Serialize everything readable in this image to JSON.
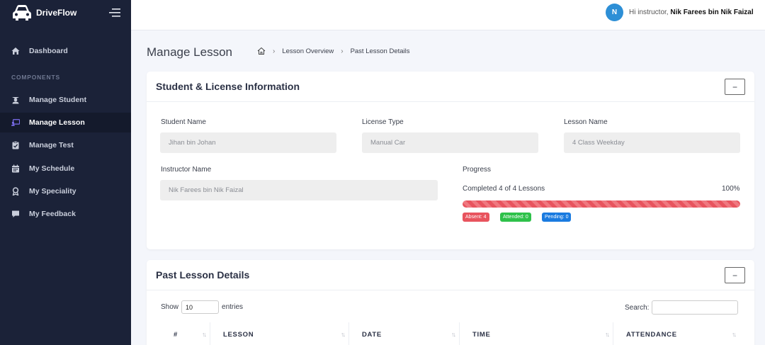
{
  "brand": {
    "name": "DriveFlow"
  },
  "sidebar": {
    "section_label": "COMPONENTS",
    "items": [
      {
        "label": "Dashboard",
        "icon": "home-icon"
      },
      {
        "label": "Manage Student",
        "icon": "student-icon"
      },
      {
        "label": "Manage Lesson",
        "icon": "lesson-icon",
        "active": true
      },
      {
        "label": "Manage Test",
        "icon": "clipboard-icon"
      },
      {
        "label": "My Schedule",
        "icon": "calendar-icon"
      },
      {
        "label": "My Speciality",
        "icon": "award-icon"
      },
      {
        "label": "My Feedback",
        "icon": "comment-icon"
      }
    ]
  },
  "topbar": {
    "avatar_initial": "N",
    "greeting": "Hi instructor,",
    "user_name": "Nik Farees bin Nik Faizal"
  },
  "page": {
    "title": "Manage Lesson",
    "breadcrumb": [
      "Lesson Overview",
      "Past Lesson Details"
    ]
  },
  "info_card": {
    "title": "Student & License Information",
    "collapse_symbol": "−",
    "student_name_label": "Student Name",
    "student_name": "Jihan bin Johan",
    "license_type_label": "License Type",
    "license_type": "Manual Car",
    "lesson_name_label": "Lesson Name",
    "lesson_name": "4 Class Weekday",
    "instructor_name_label": "Instructor Name",
    "instructor_name": "Nik Farees bin Nik Faizal",
    "progress_label": "Progress",
    "progress_text": "Completed 4 of 4 Lessons",
    "progress_percent": "100%",
    "progress_value": 1.0,
    "badges": {
      "absent": "Absent: 4",
      "attended": "Attended: 0",
      "pending": "Pending: 0"
    },
    "colors": {
      "absent": "#e8545e",
      "attended": "#2ec14a",
      "pending": "#1a7be0"
    }
  },
  "lessons_card": {
    "title": "Past Lesson Details",
    "collapse_symbol": "−",
    "show_label": "Show",
    "entries_value": "10",
    "entries_label": "entries",
    "search_label": "Search:",
    "columns": [
      "#",
      "LESSON",
      "DATE",
      "TIME",
      "ATTENDANCE"
    ]
  }
}
